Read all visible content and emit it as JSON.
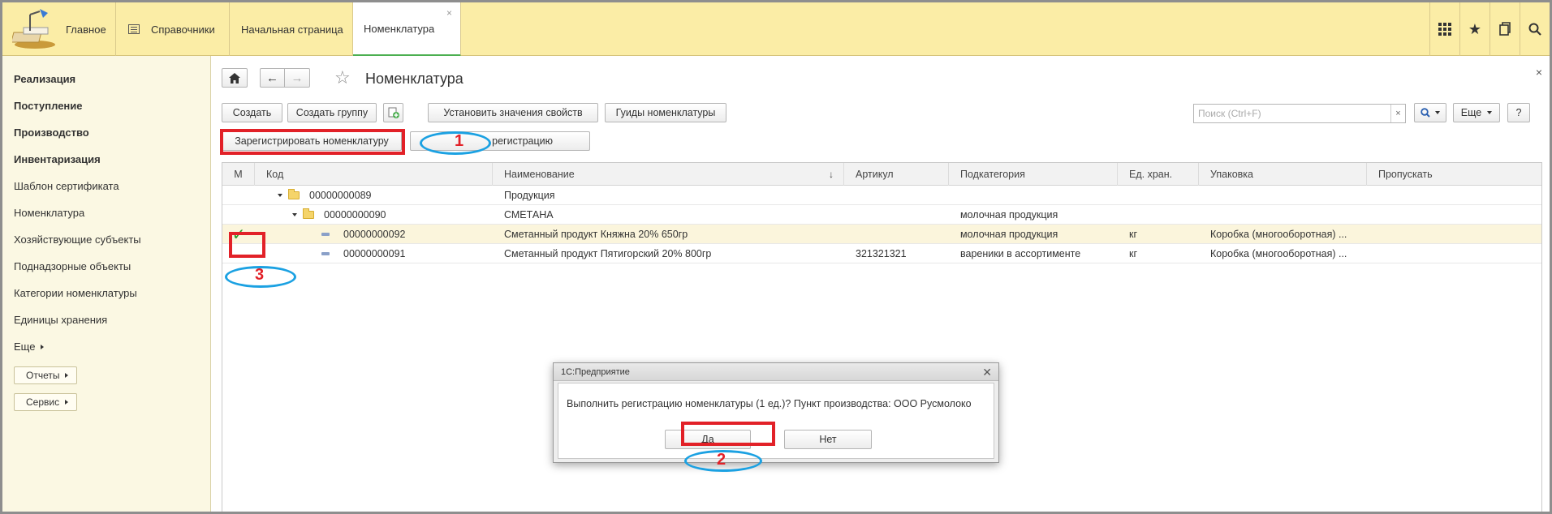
{
  "topbar": {
    "tabs": [
      "Главное",
      "Справочники",
      "Начальная страница",
      "Номенклатура"
    ],
    "active_tab_close": "×"
  },
  "sidebar": {
    "bold_items": [
      "Реализация",
      "Поступление",
      "Производство",
      "Инвентаризация"
    ],
    "items": [
      "Шаблон сертификата",
      "Номенклатура",
      "Хозяйствующие субъекты",
      "Поднадзорные объекты",
      "Категории номенклатуры",
      "Единицы хранения"
    ],
    "more": "Еще",
    "buttons": [
      "Отчеты",
      "Сервис"
    ]
  },
  "header": {
    "title": "Номенклатура",
    "close": "×"
  },
  "toolbar": {
    "create": "Создать",
    "create_group": "Создать группу",
    "set_props": "Установить значения свойств",
    "guids": "Гуиды номенклатуры",
    "register": "Зарегистрировать номенклатуру",
    "cancel_register": "регистрацию",
    "search_placeholder": "Поиск (Ctrl+F)",
    "search_clear": "×",
    "more": "Еще",
    "help": "?"
  },
  "table": {
    "columns": [
      "М",
      "Код",
      "Наименование",
      "Артикул",
      "Подкатегория",
      "Ед. хран.",
      "Упаковка",
      "Пропускать"
    ],
    "sort_indicator": "↓",
    "rows": [
      {
        "mark": "",
        "code": "00000000089",
        "name": "Продукция",
        "article": "",
        "subcat": "",
        "unit": "",
        "pack": "",
        "kind": "folder",
        "level": 1
      },
      {
        "mark": "",
        "code": "00000000090",
        "name": "СМЕТАНА",
        "article": "",
        "subcat": "молочная продукция",
        "unit": "",
        "pack": "",
        "kind": "folder",
        "level": 2
      },
      {
        "mark": "✓",
        "code": "00000000092",
        "name": "Сметанный продукт Княжна 20% 650гр",
        "article": "",
        "subcat": "молочная продукция",
        "unit": "кг",
        "pack": "Коробка (многооборотная) ...",
        "kind": "item",
        "level": 3
      },
      {
        "mark": "",
        "code": "00000000091",
        "name": "Сметанный продукт Пятигорский 20% 800гр",
        "article": "321321321",
        "subcat": "вареники в ассортименте",
        "unit": "кг",
        "pack": "Коробка (многооборотная) ...",
        "kind": "item",
        "level": 3
      }
    ]
  },
  "dialog": {
    "title": "1С:Предприятие",
    "close": "✕",
    "message": "Выполнить регистрацию номенклатуры (1 ед.)? Пункт производства: ООО Русмолоко",
    "yes": "Да",
    "no": "Нет"
  },
  "annotations": [
    "1",
    "2",
    "3"
  ],
  "colors": {
    "topbar": "#fbeda6",
    "sidebar": "#fbf8e3",
    "annotation_red": "#e22128",
    "annotation_blue": "#1ba1e2",
    "active_tab_underline": "#4caf50"
  }
}
